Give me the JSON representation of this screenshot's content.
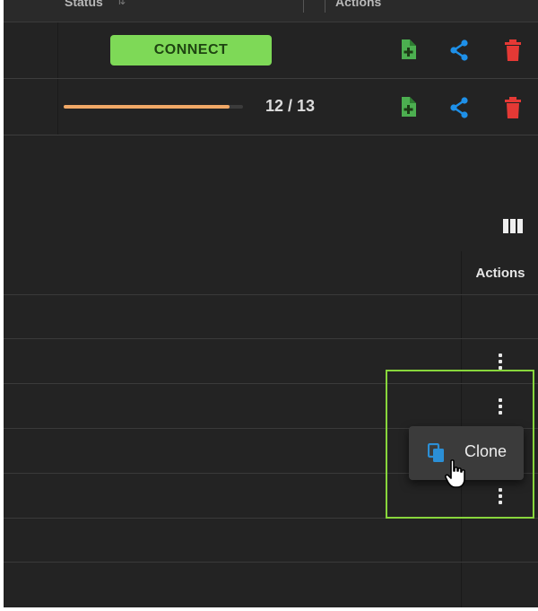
{
  "header": {
    "status_label": "Status",
    "actions_label": "Actions"
  },
  "rows": [
    {
      "connect_label": "CONNECT",
      "actions": {
        "add_icon": "file-plus-icon",
        "share_icon": "share-icon",
        "delete_icon": "trash-icon"
      }
    },
    {
      "progress": {
        "value": 12,
        "total": 13,
        "fraction": 0.923,
        "label": "12 / 13"
      },
      "actions": {
        "add_icon": "file-plus-icon",
        "share_icon": "share-icon",
        "delete_icon": "trash-icon"
      }
    }
  ],
  "grid": {
    "column_toggle_icon": "view-columns-icon",
    "actions_header": "Actions",
    "row_menu_icon": "more-vert-icon"
  },
  "context_menu": {
    "items": [
      {
        "label": "Clone",
        "icon": "content-copy-icon"
      }
    ]
  },
  "colors": {
    "background": "#232323",
    "connect_green": "#7ed957",
    "progress_orange": "#f0a866",
    "share_blue": "#1e90e8",
    "delete_red": "#e53935",
    "add_green": "#4caf50",
    "highlight_green": "#88d63c",
    "clone_icon_blue": "#2b8fd6"
  }
}
